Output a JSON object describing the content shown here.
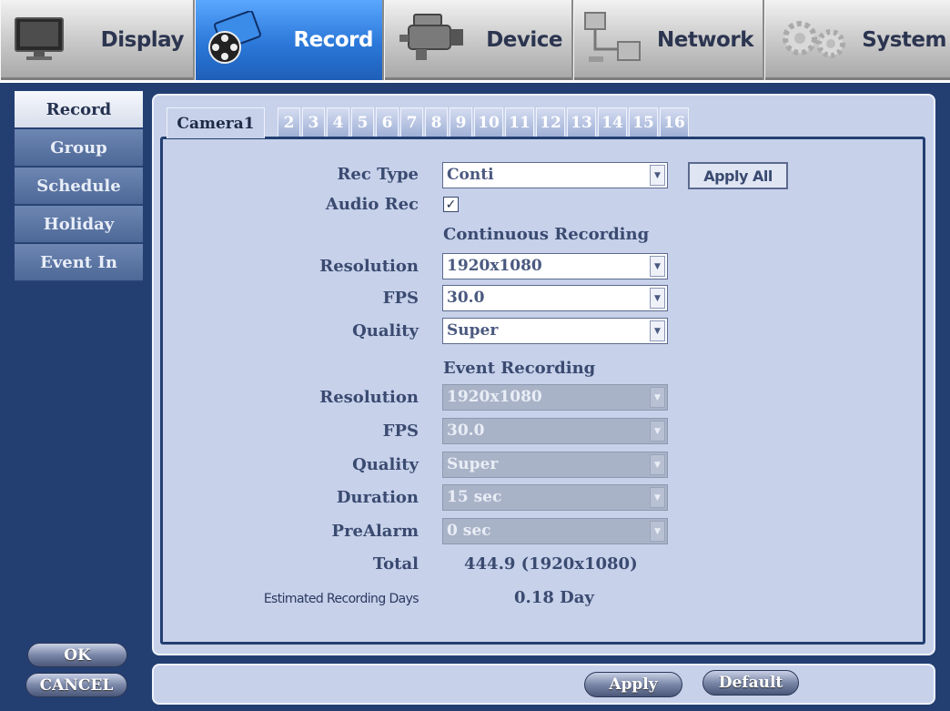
{
  "nav": {
    "tabs": [
      {
        "label": "Display",
        "icon": "monitor-icon"
      },
      {
        "label": "Record",
        "icon": "film-reel-icon"
      },
      {
        "label": "Device",
        "icon": "video-camera-icon"
      },
      {
        "label": "Network",
        "icon": "network-icon"
      },
      {
        "label": "System",
        "icon": "gears-icon"
      }
    ],
    "active": "Record"
  },
  "sidebar": {
    "items": [
      "Record",
      "Group",
      "Schedule",
      "Holiday",
      "Event In"
    ],
    "active": "Record"
  },
  "camera_tabs": [
    "Camera1",
    "2",
    "3",
    "4",
    "5",
    "6",
    "7",
    "8",
    "9",
    "10",
    "11",
    "12",
    "13",
    "14",
    "15",
    "16"
  ],
  "form": {
    "rec_type_label": "Rec Type",
    "rec_type_value": "Conti",
    "apply_all_label": "Apply All",
    "audio_rec_label": "Audio Rec",
    "audio_rec_checked": true,
    "continuous": {
      "heading": "Continuous Recording",
      "resolution_label": "Resolution",
      "resolution_value": "1920x1080",
      "fps_label": "FPS",
      "fps_value": "30.0",
      "quality_label": "Quality",
      "quality_value": "Super"
    },
    "event": {
      "heading": "Event Recording",
      "resolution_label": "Resolution",
      "resolution_value": "1920x1080",
      "fps_label": "FPS",
      "fps_value": "30.0",
      "quality_label": "Quality",
      "quality_value": "Super",
      "duration_label": "Duration",
      "duration_value": "15 sec",
      "prealarm_label": "PreAlarm",
      "prealarm_value": "0 sec"
    },
    "total_label": "Total",
    "total_value": "444.9 (1920x1080)",
    "est_days_label": "Estimated Recording Days",
    "est_days_value": "0.18 Day"
  },
  "buttons": {
    "ok": "OK",
    "cancel": "CANCEL",
    "apply": "Apply",
    "default": "Default"
  },
  "colors": {
    "frame": "#233f72",
    "panel": "#c7d1ea",
    "active_tab": "#2b78d9"
  }
}
